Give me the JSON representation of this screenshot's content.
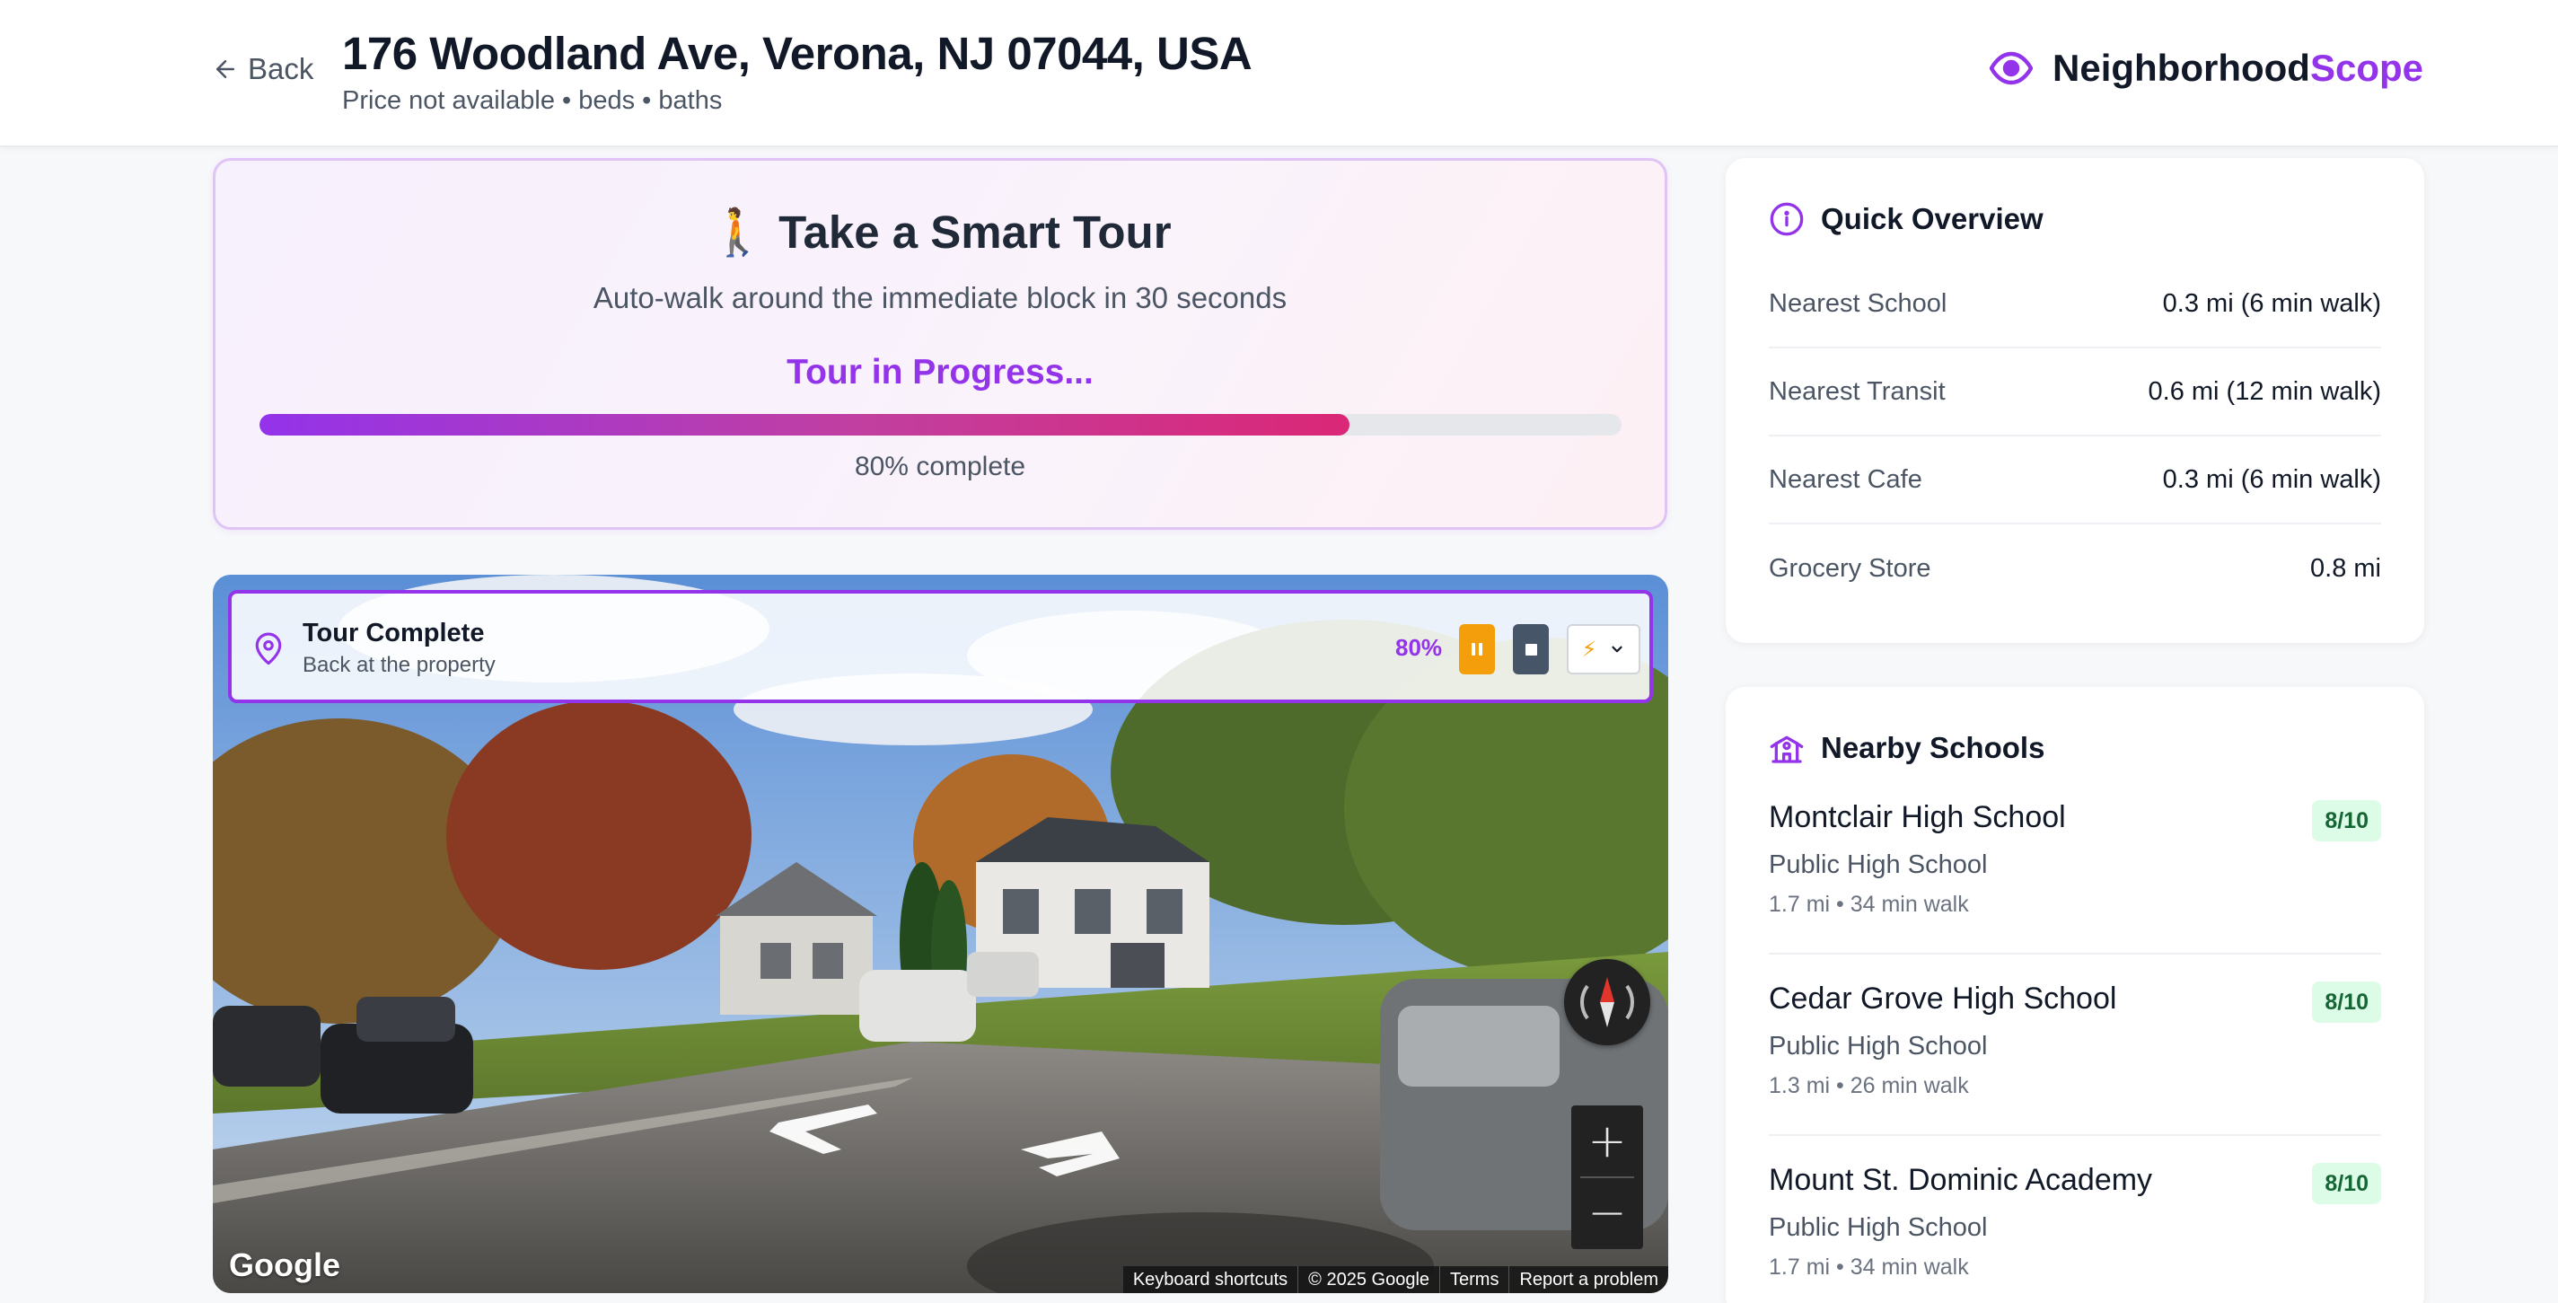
{
  "header": {
    "back_label": "Back",
    "address": "176 Woodland Ave, Verona, NJ 07044, USA",
    "subtitle": "Price not available • beds • baths",
    "brand_part1": "Neighborhood",
    "brand_part2": "Scope"
  },
  "tour": {
    "emoji": "🚶",
    "title": "Take a Smart Tour",
    "description": "Auto-walk around the immediate block in 30 seconds",
    "status": "Tour in Progress...",
    "progress_fraction": 0.8,
    "progress_text": "80% complete"
  },
  "street_view": {
    "overlay_title": "Tour Complete",
    "overlay_subtitle": "Back at the property",
    "percent": "80%",
    "speed_icon": "⚡",
    "google_logo": "Google",
    "footer_links": [
      "Keyboard shortcuts",
      "© 2025 Google",
      "Terms",
      "Report a problem"
    ],
    "zoom_in": "+",
    "zoom_out": "−"
  },
  "overview": {
    "title": "Quick Overview",
    "rows": [
      {
        "label": "Nearest School",
        "value": "0.3 mi (6 min walk)"
      },
      {
        "label": "Nearest Transit",
        "value": "0.6 mi (12 min walk)"
      },
      {
        "label": "Nearest Cafe",
        "value": "0.3 mi (6 min walk)"
      },
      {
        "label": "Grocery Store",
        "value": "0.8 mi"
      }
    ]
  },
  "schools": {
    "title": "Nearby Schools",
    "items": [
      {
        "name": "Montclair High School",
        "type": "Public High School",
        "distance": "1.7 mi • 34 min walk",
        "rating": "8/10"
      },
      {
        "name": "Cedar Grove High School",
        "type": "Public High School",
        "distance": "1.3 mi • 26 min walk",
        "rating": "8/10"
      },
      {
        "name": "Mount St. Dominic Academy",
        "type": "Public High School",
        "distance": "1.7 mi • 34 min walk",
        "rating": "8/10"
      }
    ]
  },
  "colors": {
    "accent": "#9333ea",
    "progress_end": "#db2777",
    "pause": "#f59e0b",
    "stop": "#475569",
    "rating_bg": "#dcfce7"
  }
}
